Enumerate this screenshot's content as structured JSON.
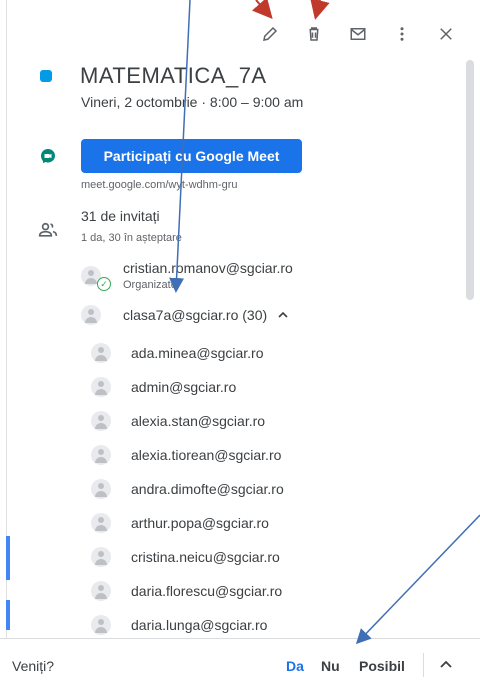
{
  "toolbar": {
    "icons": [
      "pencil-icon",
      "trash-icon",
      "mail-icon",
      "more-vert-icon",
      "close-icon"
    ]
  },
  "event": {
    "title": "MATEMATICA_7A",
    "datetime": "Vineri, 2 octombrie  ·  8:00 – 9:00 am",
    "color": "#039be5"
  },
  "meet": {
    "button_label": "Participați cu Google Meet",
    "link": "meet.google.com/wyt-wdhm-gru"
  },
  "guests": {
    "title": "31 de invitați",
    "summary": "1 da, 30 în așteptare",
    "organizer": {
      "email": "cristian.romanov@sgciar.ro",
      "role": "Organizator"
    },
    "group": "clasa7a@sgciar.ro (30)",
    "list": [
      "ada.minea@sgciar.ro",
      "admin@sgciar.ro",
      "alexia.stan@sgciar.ro",
      "alexia.tiorean@sgciar.ro",
      "andra.dimofte@sgciar.ro",
      "arthur.popa@sgciar.ro",
      "cristina.neicu@sgciar.ro",
      "daria.florescu@sgciar.ro",
      "daria.lunga@sgciar.ro"
    ]
  },
  "footer": {
    "question": "Veniți?",
    "yes": "Da",
    "no": "Nu",
    "maybe": "Posibil"
  },
  "colors": {
    "accent": "#1a73e8",
    "annotation_arrow": "#3f6fb5",
    "annotation_red": "#c0392b"
  }
}
